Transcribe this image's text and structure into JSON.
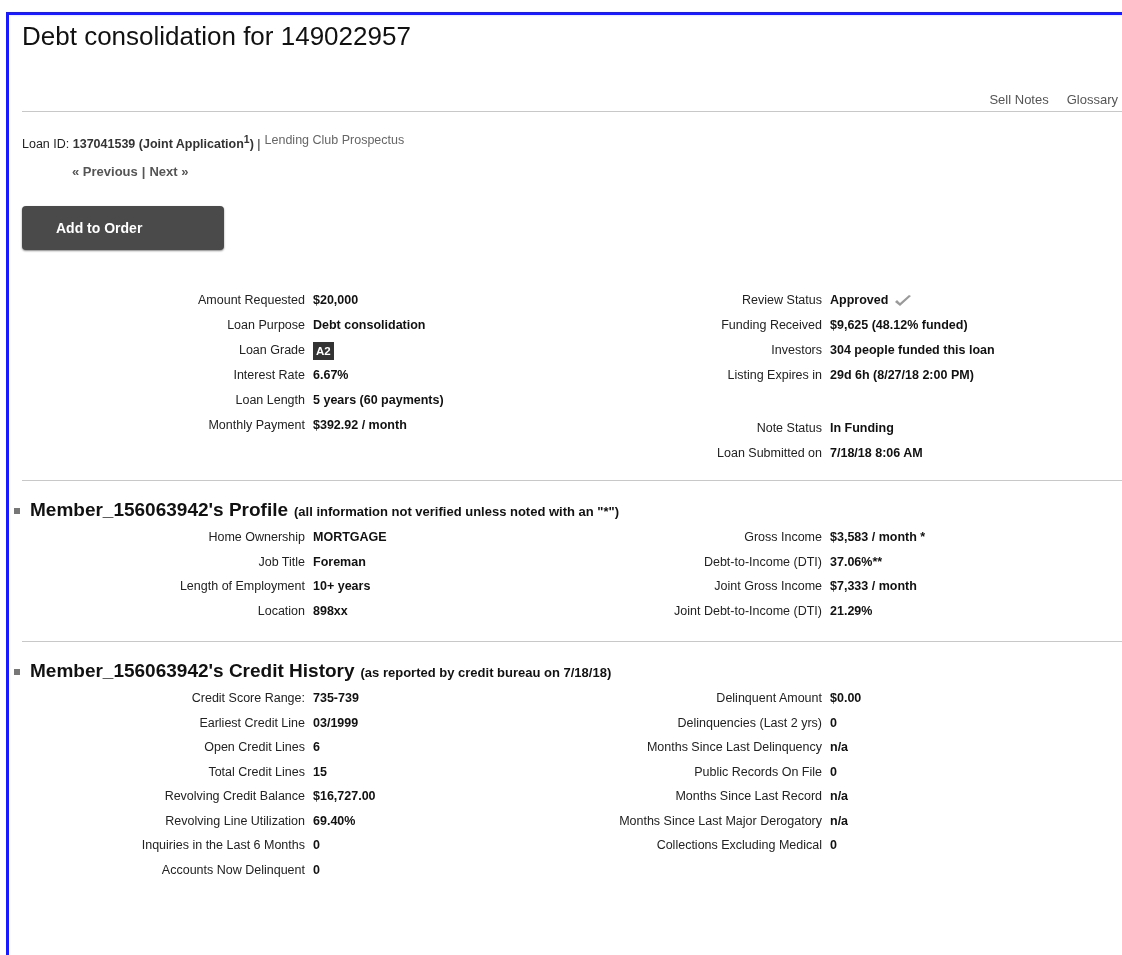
{
  "page": {
    "title": "Debt consolidation for 149022957"
  },
  "top_links": [
    "Sell Notes",
    "Glossary"
  ],
  "loan_line": {
    "text": "Loan ID: **137041539 (Joint Application$^{1}$)** |",
    "link": "Lending Club Prospectus"
  },
  "pager": {
    "previous": "« Previous",
    "separator": "|",
    "next": "Next »"
  },
  "add_button": "Add to Order",
  "sections": [
    {
      "columns": [
        [
          [
            {
              "label": "Amount Requested",
              "value": "$20,000",
              "kind": "text"
            },
            {
              "label": "Loan Purpose",
              "value": "Debt consolidation",
              "kind": "text"
            },
            {
              "label": "Loan Grade",
              "value": "A2",
              "kind": "badge"
            },
            {
              "label": "Interest Rate",
              "value": "6.67%",
              "kind": "text"
            },
            {
              "label": "Loan Length",
              "value": "5 years (60 payments)",
              "kind": "text"
            },
            {
              "label": "Monthly Payment",
              "value": "$392.92 / month",
              "kind": "text"
            }
          ]
        ],
        [
          [
            {
              "label": "Review Status",
              "value": "Approved",
              "kind": "verified"
            },
            {
              "label": "Funding Received",
              "value": "$9,625 (48.12% funded)",
              "kind": "text"
            },
            {
              "label": "Investors",
              "value": "304 people funded this loan",
              "kind": "text"
            },
            {
              "label": "Listing Expires in",
              "value": "29d 6h (8/27/18 2:00 PM)",
              "kind": "text"
            }
          ],
          [
            {
              "label": "Note Status",
              "value": "In Funding",
              "kind": "text"
            },
            {
              "label": "Loan Submitted on",
              "value": "7/18/18 8:06 AM",
              "kind": "text"
            }
          ]
        ]
      ]
    },
    {
      "heading": "Member_156063942's Profile",
      "note": "(all information not verified unless noted with an \"*\")",
      "columns": [
        [
          [
            {
              "label": "Home Ownership",
              "value": "MORTGAGE"
            },
            {
              "label": "Job Title",
              "value": "Foreman"
            },
            {
              "label": "Length of Employment",
              "value": "10+ years"
            },
            {
              "label": "Location",
              "value": "898xx"
            }
          ]
        ],
        [
          [
            {
              "label": "Gross Income",
              "value": "$3,583 / month *"
            },
            {
              "label": "Debt-to-Income (DTI)",
              "value": "37.06%**"
            },
            {
              "label": "Joint Gross Income",
              "value": "$7,333 / month"
            },
            {
              "label": "Joint Debt-to-Income (DTI)",
              "value": "21.29%"
            }
          ]
        ]
      ]
    },
    {
      "heading": "Member_156063942's Credit History",
      "note": "(as reported by credit bureau on 7/18/18)",
      "columns": [
        [
          [
            {
              "label": "Credit Score Range:",
              "value": "735-739"
            },
            {
              "label": "Earliest Credit Line",
              "value": "03/1999"
            },
            {
              "label": "Open Credit Lines",
              "value": "6"
            },
            {
              "label": "Total Credit Lines",
              "value": "15"
            },
            {
              "label": "Revolving Credit Balance",
              "value": "$16,727.00"
            },
            {
              "label": "Revolving Line Utilization",
              "value": "69.40%"
            },
            {
              "label": "Inquiries in the Last 6 Months",
              "value": "0"
            },
            {
              "label": "Accounts Now Delinquent",
              "value": "0"
            }
          ]
        ],
        [
          [
            {
              "label": "Delinquent Amount",
              "value": "$0.00"
            },
            {
              "label": "Delinquencies (Last 2 yrs)",
              "value": "0"
            },
            {
              "label": "Months Since Last Delinquency",
              "value": "n/a"
            },
            {
              "label": "Public Records On File",
              "value": "0"
            },
            {
              "label": "Months Since Last Record",
              "value": "n/a"
            },
            {
              "label": "Months Since Last Major Derogatory",
              "value": "n/a"
            },
            {
              "label": "Collections Excluding Medical",
              "value": "0"
            }
          ]
        ]
      ]
    }
  ]
}
